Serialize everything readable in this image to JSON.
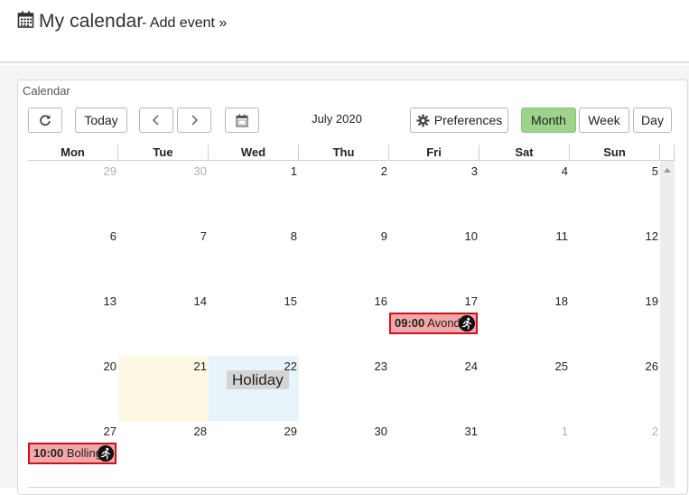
{
  "header": {
    "title": "My calendar",
    "add_event": "- Add event »",
    "icon": "calendar-icon"
  },
  "panel": {
    "title": "Calendar"
  },
  "toolbar": {
    "refresh_icon": "refresh-icon",
    "today_label": "Today",
    "prev_icon": "chevron-left-icon",
    "next_icon": "chevron-right-icon",
    "ics_icon": "ics-calendar-icon",
    "month_title": "July 2020",
    "preferences_label": "Preferences",
    "preferences_icon": "gear-icon",
    "views": [
      {
        "label": "Month",
        "active": true
      },
      {
        "label": "Week",
        "active": false
      },
      {
        "label": "Day",
        "active": false
      }
    ]
  },
  "weekdays": [
    "Mon",
    "Tue",
    "Wed",
    "Thu",
    "Fri",
    "Sat",
    "Sun"
  ],
  "weeks": [
    [
      "29",
      "30",
      "1",
      "2",
      "3",
      "4",
      "5"
    ],
    [
      "6",
      "7",
      "8",
      "9",
      "10",
      "11",
      "12"
    ],
    [
      "13",
      "14",
      "15",
      "16",
      "17",
      "18",
      "19"
    ],
    [
      "20",
      "21",
      "22",
      "23",
      "24",
      "25",
      "26"
    ],
    [
      "27",
      "28",
      "29",
      "30",
      "31",
      "1",
      "2"
    ]
  ],
  "holiday": {
    "label": "Holiday"
  },
  "events": [
    {
      "time": "10:00",
      "title": "Bolling",
      "icon": "running-icon"
    },
    {
      "time": "09:00",
      "title": "Avond",
      "icon": "running-icon"
    }
  ],
  "colors": {
    "accent_active": "#9ed38e",
    "event_bg": "#f4a7a7",
    "event_border": "#cc1020",
    "today_bg": "#fcf8e3",
    "holiday_bg": "#e8f4fa"
  }
}
